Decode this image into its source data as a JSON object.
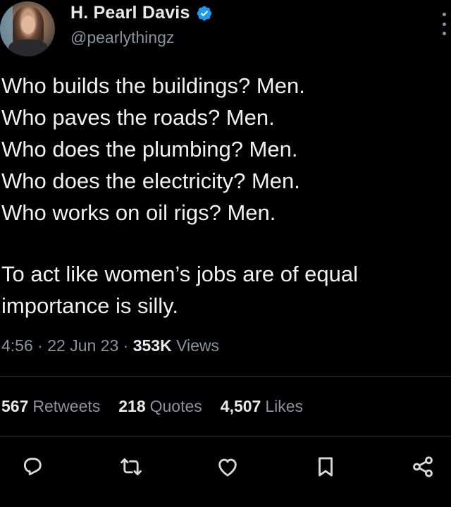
{
  "author": {
    "display_name": "H. Pearl Davis",
    "handle": "@pearlythingz",
    "verified": true
  },
  "tweet": {
    "lines": [
      "Who builds the buildings? Men.",
      "Who paves the roads? Men.",
      "Who does the plumbing? Men.",
      "Who does the electricity? Men.",
      "Who works on oil rigs? Men."
    ],
    "paragraph2": [
      "To act like women’s jobs are of equal",
      "importance is silly."
    ]
  },
  "meta": {
    "time": "4:56",
    "separator": " · ",
    "date": "22 Jun 23",
    "views_count": "353K",
    "views_label": " Views"
  },
  "stats": {
    "retweets_count": "567",
    "retweets_label": "Retweets",
    "quotes_count": "218",
    "quotes_label": "Quotes",
    "likes_count": "4,507",
    "likes_label": "Likes"
  },
  "icons": {
    "reply": "reply-icon",
    "retweet": "retweet-icon",
    "like": "heart-icon",
    "bookmark": "bookmark-icon",
    "share": "share-icon",
    "more": "more-vertical-icon",
    "verified": "verified-badge-icon"
  },
  "colors": {
    "background": "#000000",
    "text": "#e7e9ea",
    "secondary_text": "#8b949a",
    "verified_blue": "#1d9bf0",
    "divider": "#2f3336"
  }
}
